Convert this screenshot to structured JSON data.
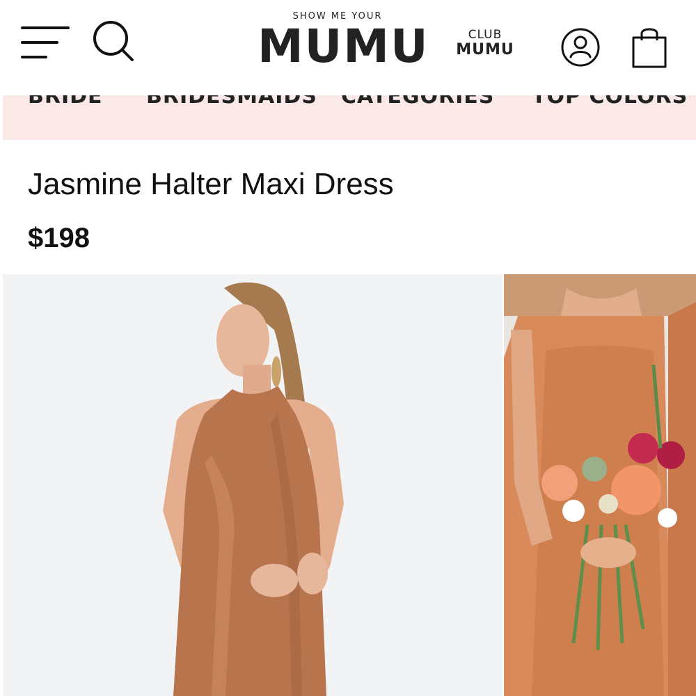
{
  "header": {
    "menu_icon": "hamburger-menu-icon",
    "search_icon": "search-icon",
    "logo_small": "SHOW ME YOUR",
    "logo_big": "MUMU",
    "club_top": "CLUB",
    "club_bottom": "MUMU",
    "account_icon": "user-account-icon",
    "bag_icon": "shopping-bag-icon"
  },
  "nav": {
    "items": [
      {
        "label": "BRIDE"
      },
      {
        "label": "BRIDESMAIDS"
      },
      {
        "label": "CATEGORIES"
      },
      {
        "label": "TOP COLORS"
      }
    ]
  },
  "product": {
    "title": "Jasmine Halter Maxi Dress",
    "price": "$198"
  },
  "colors": {
    "nav_background": "#fbe9e7",
    "dress": "#b8744d",
    "text": "#111111"
  }
}
